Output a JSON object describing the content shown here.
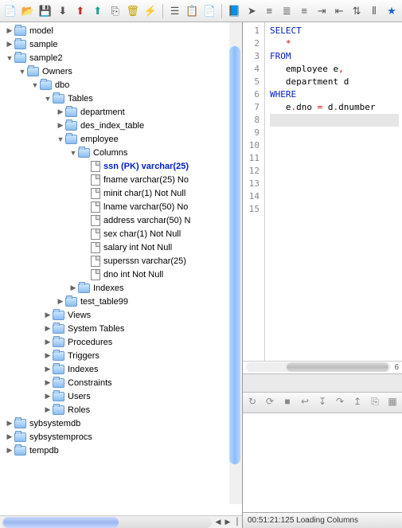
{
  "toolbar": {
    "icons": [
      "new-file",
      "open-folder",
      "save",
      "import",
      "export-red",
      "export-teal",
      "copy",
      "delete",
      "run",
      "sep",
      "properties",
      "copy-doc",
      "paste-doc",
      "sep",
      "book",
      "pointer",
      "align-left",
      "align-center",
      "align-right",
      "indent",
      "outdent",
      "sort",
      "columns",
      "star"
    ]
  },
  "tree": [
    {
      "depth": 0,
      "tw": "▶",
      "icon": "folder",
      "label": "model"
    },
    {
      "depth": 0,
      "tw": "▶",
      "icon": "folder",
      "label": "sample"
    },
    {
      "depth": 0,
      "tw": "▼",
      "icon": "folder",
      "label": "sample2"
    },
    {
      "depth": 1,
      "tw": "▼",
      "icon": "folder",
      "label": "Owners"
    },
    {
      "depth": 2,
      "tw": "▼",
      "icon": "folder",
      "label": "dbo"
    },
    {
      "depth": 3,
      "tw": "▼",
      "icon": "folder",
      "label": "Tables"
    },
    {
      "depth": 4,
      "tw": "▶",
      "icon": "folder",
      "label": "department"
    },
    {
      "depth": 4,
      "tw": "▶",
      "icon": "folder",
      "label": "des_index_table"
    },
    {
      "depth": 4,
      "tw": "▼",
      "icon": "folder",
      "label": "employee"
    },
    {
      "depth": 5,
      "tw": "▼",
      "icon": "folder",
      "label": "Columns"
    },
    {
      "depth": 6,
      "tw": "",
      "icon": "file",
      "label": "ssn (PK) varchar(25)",
      "pk": true
    },
    {
      "depth": 6,
      "tw": "",
      "icon": "file",
      "label": "fname varchar(25) No"
    },
    {
      "depth": 6,
      "tw": "",
      "icon": "file",
      "label": "minit char(1) Not Null"
    },
    {
      "depth": 6,
      "tw": "",
      "icon": "file",
      "label": "lname varchar(50) No"
    },
    {
      "depth": 6,
      "tw": "",
      "icon": "file",
      "label": "address varchar(50) N"
    },
    {
      "depth": 6,
      "tw": "",
      "icon": "file",
      "label": "sex char(1) Not Null"
    },
    {
      "depth": 6,
      "tw": "",
      "icon": "file",
      "label": "salary int Not Null"
    },
    {
      "depth": 6,
      "tw": "",
      "icon": "file",
      "label": "superssn varchar(25)"
    },
    {
      "depth": 6,
      "tw": "",
      "icon": "file",
      "label": "dno int Not Null"
    },
    {
      "depth": 5,
      "tw": "▶",
      "icon": "folder",
      "label": "Indexes"
    },
    {
      "depth": 4,
      "tw": "▶",
      "icon": "folder",
      "label": "test_table99"
    },
    {
      "depth": 3,
      "tw": "▶",
      "icon": "folder",
      "label": "Views"
    },
    {
      "depth": 3,
      "tw": "▶",
      "icon": "folder",
      "label": "System Tables"
    },
    {
      "depth": 3,
      "tw": "▶",
      "icon": "folder",
      "label": "Procedures"
    },
    {
      "depth": 3,
      "tw": "▶",
      "icon": "folder",
      "label": "Triggers"
    },
    {
      "depth": 3,
      "tw": "▶",
      "icon": "folder",
      "label": "Indexes"
    },
    {
      "depth": 3,
      "tw": "▶",
      "icon": "folder",
      "label": "Constraints"
    },
    {
      "depth": 3,
      "tw": "▶",
      "icon": "folder",
      "label": "Users"
    },
    {
      "depth": 3,
      "tw": "▶",
      "icon": "folder",
      "label": "Roles"
    },
    {
      "depth": 0,
      "tw": "▶",
      "icon": "folder",
      "label": "sybsystemdb"
    },
    {
      "depth": 0,
      "tw": "▶",
      "icon": "folder",
      "label": "sybsystemprocs"
    },
    {
      "depth": 0,
      "tw": "▶",
      "icon": "folder",
      "label": "tempdb"
    }
  ],
  "editor": {
    "lines": [
      {
        "n": 1,
        "segs": [
          {
            "t": "SELECT",
            "c": "kw"
          }
        ]
      },
      {
        "n": 2,
        "segs": [
          {
            "t": "   "
          },
          {
            "t": "*",
            "c": "op"
          }
        ]
      },
      {
        "n": 3,
        "segs": [
          {
            "t": "FROM",
            "c": "kw"
          }
        ]
      },
      {
        "n": 4,
        "segs": [
          {
            "t": "   employee e"
          },
          {
            "t": ",",
            "c": "op"
          }
        ]
      },
      {
        "n": 5,
        "segs": [
          {
            "t": "   department d"
          }
        ]
      },
      {
        "n": 6,
        "segs": [
          {
            "t": "WHERE",
            "c": "kw"
          }
        ]
      },
      {
        "n": 7,
        "segs": [
          {
            "t": "   e"
          },
          {
            "t": ".",
            "c": "op"
          },
          {
            "t": "dno "
          },
          {
            "t": "=",
            "c": "op"
          },
          {
            "t": " d"
          },
          {
            "t": ".",
            "c": "op"
          },
          {
            "t": "dnumber"
          }
        ]
      },
      {
        "n": 8,
        "segs": [],
        "cur": true
      },
      {
        "n": 9,
        "segs": []
      },
      {
        "n": 10,
        "segs": []
      },
      {
        "n": 11,
        "segs": []
      },
      {
        "n": 12,
        "segs": []
      },
      {
        "n": 13,
        "segs": []
      },
      {
        "n": 14,
        "segs": []
      },
      {
        "n": 15,
        "segs": []
      }
    ],
    "hscroll_label": "6"
  },
  "lower_toolbar": {
    "icons": [
      "refresh",
      "refresh-all",
      "stop",
      "step-back",
      "step-in",
      "step-over",
      "step-out",
      "copy",
      "grid"
    ]
  },
  "status": {
    "text": "00:51:21:125 Loading Columns"
  }
}
